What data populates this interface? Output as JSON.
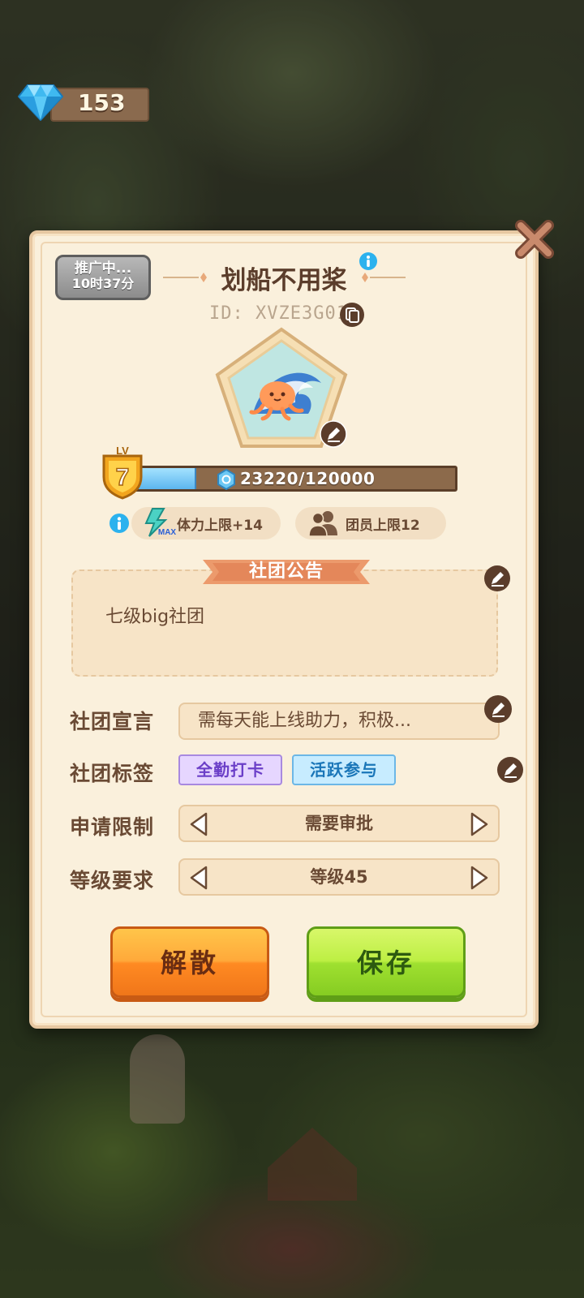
{
  "currency": {
    "icon": "diamond-icon",
    "amount": "153"
  },
  "club": {
    "promo_line1": "推广中...",
    "promo_line2": "10时37分",
    "name": "划船不用桨",
    "id_label": "ID: XVZE3G01",
    "level_badge_label": "LV",
    "level": "7",
    "xp_text": "23220/120000",
    "xp_progress": 0.1935
  },
  "perks": [
    {
      "icon": "stamina-max-icon",
      "label": "体力上限+14"
    },
    {
      "icon": "members-icon",
      "label": "团员上限12"
    }
  ],
  "perk_icon_badge": "MAX",
  "notice": {
    "title": "社团公告",
    "text": "七级big社团"
  },
  "form": {
    "motto_label": "社团宣言",
    "motto_value": "需每天能上线助力，积极...",
    "tags_label": "社团标签",
    "tags": [
      "全勤打卡",
      "活跃参与"
    ],
    "apply_label": "申请限制",
    "apply_value": "需要审批",
    "level_req_label": "等级要求",
    "level_req_value": "等级45"
  },
  "buttons": {
    "disband": "解散",
    "save": "保存"
  },
  "colors": {
    "panel_bg": "#faf0dc",
    "text_brown": "#6a4a34",
    "disband_orange": "#ff8a22",
    "save_green": "#9fe030",
    "xp_blue": "#5cb6ee"
  }
}
